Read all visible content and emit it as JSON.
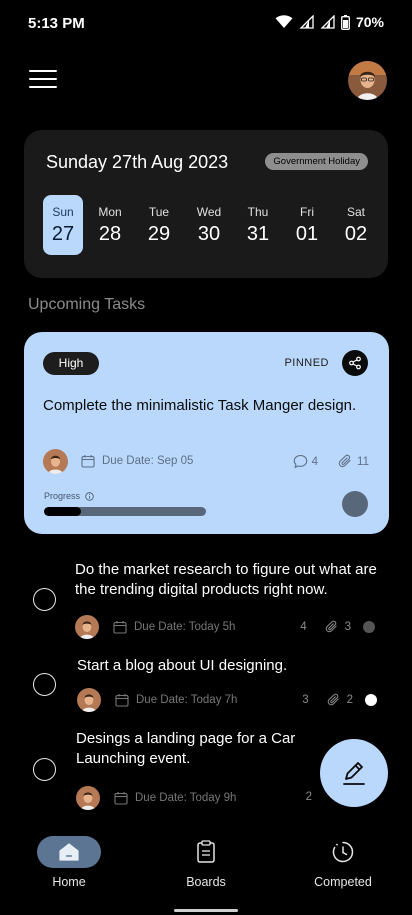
{
  "status_bar": {
    "time": "5:13 PM",
    "battery": "70%",
    "icons": [
      "wifi-icon",
      "signal-icon",
      "signal-icon",
      "battery-icon"
    ]
  },
  "header": {
    "menu_icon": "hamburger-menu-icon",
    "avatar": "profile-avatar"
  },
  "date_card": {
    "title": "Sunday 27th Aug 2023",
    "badge": "Government Holiday",
    "days": [
      {
        "name": "Sun",
        "num": "27",
        "active": true
      },
      {
        "name": "Mon",
        "num": "28",
        "active": false
      },
      {
        "name": "Tue",
        "num": "29",
        "active": false
      },
      {
        "name": "Wed",
        "num": "30",
        "active": false
      },
      {
        "name": "Thu",
        "num": "31",
        "active": false
      },
      {
        "name": "Fri",
        "num": "01",
        "active": false
      },
      {
        "name": "Sat",
        "num": "02",
        "active": false
      }
    ]
  },
  "section_title": "Upcoming Tasks",
  "pinned_task": {
    "priority": "High",
    "pinned_label": "PINNED",
    "title": "Complete the minimalistic Task Manger design.",
    "due": "Due Date: Sep 05",
    "comments": "4",
    "attachments": "11",
    "progress_label": "Progress",
    "progress": 0.23
  },
  "tasks": [
    {
      "title": "Do the market research to figure out what are the trending digital products right now.",
      "due": "Due Date: Today 5h",
      "comments": "4",
      "attachments": "3",
      "status_color": "#555555"
    },
    {
      "title": "Start a blog about UI designing.",
      "due": "Due Date: Today 7h",
      "comments": "3",
      "attachments": "2",
      "status_color": "#ffffff"
    },
    {
      "title": "Desings a landing page for a Car Launching event.",
      "due": "Due Date: Today 9h",
      "comments": "2",
      "attachments": "",
      "status_color": ""
    }
  ],
  "bottom_nav": {
    "items": [
      {
        "label": "Home",
        "icon": "home-icon",
        "active": true
      },
      {
        "label": "Boards",
        "icon": "clipboard-icon",
        "active": false
      },
      {
        "label": "Competed",
        "icon": "clock-icon",
        "active": false
      }
    ]
  },
  "colors": {
    "accent": "#b9d8fb",
    "background": "#000000",
    "card": "#1a1a1a",
    "nav_active": "#5c7593"
  }
}
